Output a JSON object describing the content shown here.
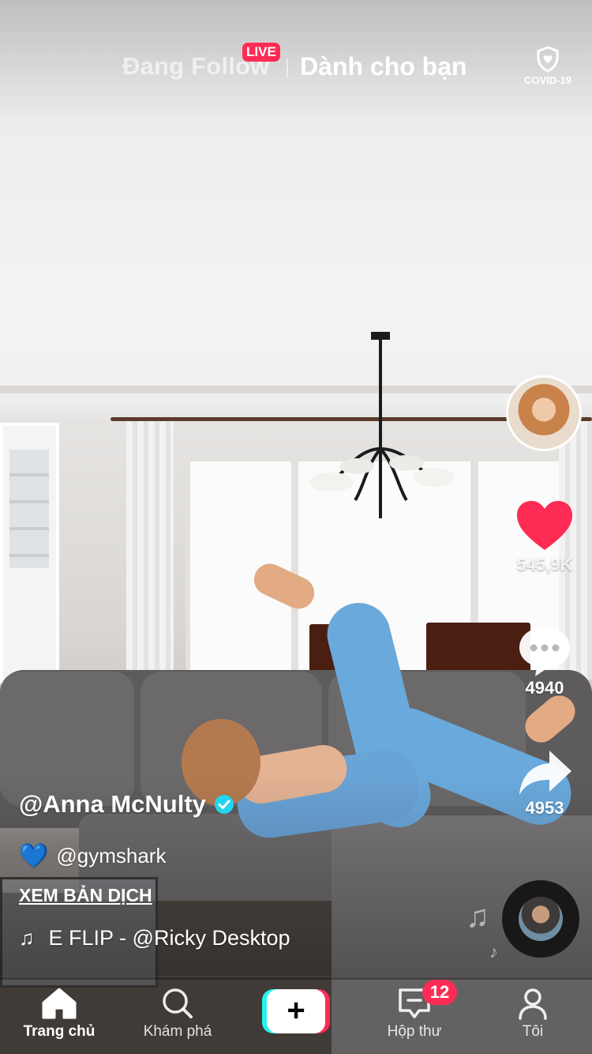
{
  "top_tabs": {
    "following_label": "Đang Follow",
    "live_badge": "LIVE",
    "for_you_label": "Dành cho bạn",
    "covid_label": "COVID-19"
  },
  "video": {
    "author": "@Anna McNulty",
    "caption_mention": "@gymshark",
    "caption_emoji_icon": "blue-heart-icon",
    "translate_label": "XEM BẢN DỊCH",
    "music_text": "E FLIP - @Ricky Desktop"
  },
  "actions": {
    "likes": "545,9K",
    "comments": "4940",
    "shares": "4953"
  },
  "colors": {
    "like_red": "#fe2c55",
    "verified_blue": "#20d5ec",
    "create_cyan": "#25f4ee",
    "create_pink": "#fe2c55"
  },
  "bottom_nav": {
    "home": "Trang chủ",
    "explore": "Khám phá",
    "inbox": "Hộp thư",
    "inbox_badge": "12",
    "me": "Tôi",
    "create": "+"
  }
}
